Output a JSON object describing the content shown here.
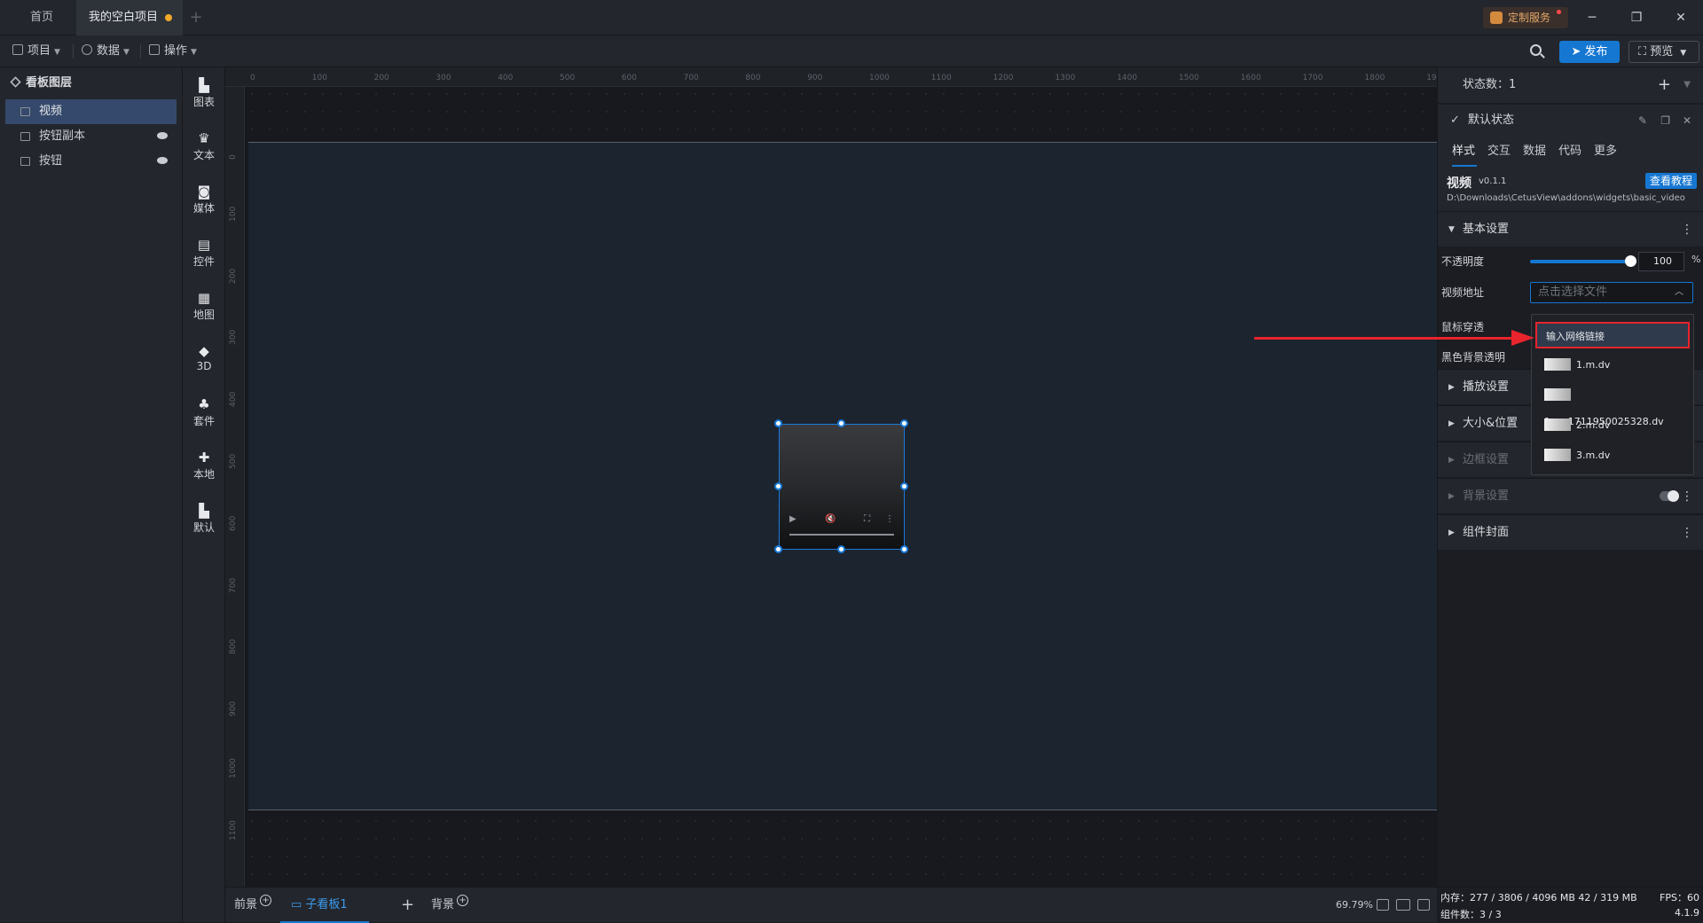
{
  "tabs": {
    "home": "首页",
    "project": "我的空白项目",
    "add": "+"
  },
  "titlebar": {
    "custom_service": "定制服务",
    "minimize": "─",
    "restore": "❐",
    "close": "✕"
  },
  "menubar": {
    "project": "项目",
    "data": "数据",
    "operate": "操作",
    "publish": "发布",
    "preview": "预览"
  },
  "layers": {
    "title": "看板图层",
    "items": [
      {
        "label": "视频",
        "active": true
      },
      {
        "label": "按钮副本"
      },
      {
        "label": "按钮"
      }
    ]
  },
  "components": [
    "图表",
    "文本",
    "媒体",
    "控件",
    "地图",
    "3D",
    "套件",
    "本地",
    "默认"
  ],
  "ruler": {
    "top": [
      "0",
      "100",
      "200",
      "300",
      "400",
      "500",
      "600",
      "700",
      "800",
      "900",
      "1000",
      "1100",
      "1200",
      "1300",
      "1400",
      "1500",
      "1600",
      "1700",
      "1800",
      "1900"
    ],
    "left": [
      "0",
      "100",
      "200",
      "300",
      "400",
      "500",
      "600",
      "700",
      "800",
      "900",
      "1000",
      "1100"
    ]
  },
  "video_controls": {
    "play": "▶",
    "mute": "🔇",
    "fullscreen": "⛶",
    "more": "⋮"
  },
  "bottombar": {
    "front": "前景",
    "sub_board": "子看板1",
    "add": "+",
    "background": "背景",
    "zoom": "69.79%"
  },
  "right_panel": {
    "state_count": "状态数：1",
    "default_state": "默认状态",
    "tabs": [
      "样式",
      "交互",
      "数据",
      "代码",
      "更多"
    ],
    "widget_name": "视频",
    "widget_version": "v0.1.1",
    "tutorial": "查看教程",
    "widget_path": "D:\\Downloads\\CetusView\\addons\\widgets\\basic_video",
    "sections": {
      "basic": "基本设置",
      "play": "播放设置",
      "size": "大小&位置",
      "border": "边框设置",
      "bg": "背景设置",
      "cover": "组件封面"
    },
    "props": {
      "opacity_label": "不透明度",
      "opacity_value": "100",
      "opacity_unit": "%",
      "opacity_level": 1.0,
      "video_url_label": "视频地址",
      "video_url_placeholder": "点击选择文件",
      "mouse_through_label": "鼠标穿透",
      "black_bg_label": "黑色背景透明"
    }
  },
  "dropdown": {
    "items": [
      "输入网络链接",
      "1.m.dv",
      "1.m_1711950025328.dv",
      "2.m.dv",
      "3.m.dv"
    ]
  },
  "status": {
    "memory": "内存：277 / 3806 / 4096 MB  42 / 319 MB",
    "fps": "FPS：60",
    "components": "组件数：3 / 3",
    "version": "4.1.9"
  },
  "colors": {
    "accent": "#1677d2",
    "annotation": "#e8242c"
  }
}
